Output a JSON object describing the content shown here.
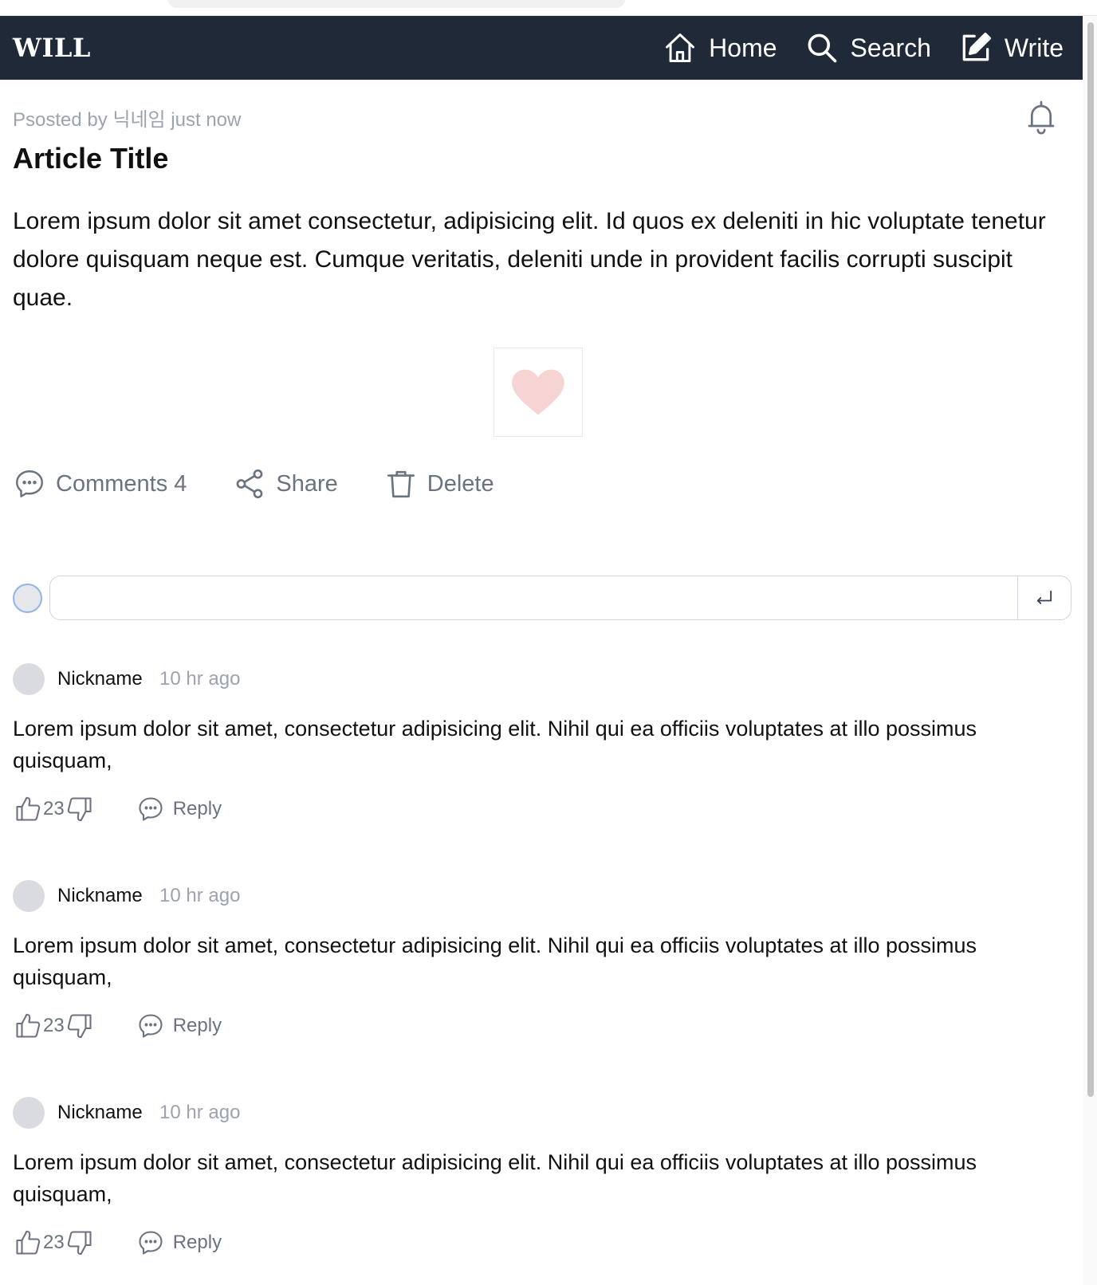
{
  "nav": {
    "logo": "WILL",
    "home_label": "Home",
    "search_label": "Search",
    "write_label": "Write"
  },
  "article": {
    "meta": "Psosted by 닉네임 just now",
    "title": "Article Title",
    "body": "Lorem ipsum dolor sit amet consectetur, adipisicing elit. Id quos ex deleniti in hic voluptate tenetur dolore quisquam neque est. Cumque veritatis, deleniti unde in provident facilis corrupti suscipit quae."
  },
  "actions": {
    "comments_label": "Comments 4",
    "share_label": "Share",
    "delete_label": "Delete"
  },
  "comment_form": {
    "placeholder": ""
  },
  "comments": [
    {
      "nickname": "Nickname",
      "time": "10 hr ago",
      "text": "Lorem ipsum dolor sit amet, consectetur adipisicing elit. Nihil qui ea officiis voluptates at illo possimus quisquam,",
      "likes": "23",
      "reply_label": "Reply"
    },
    {
      "nickname": "Nickname",
      "time": "10 hr ago",
      "text": "Lorem ipsum dolor sit amet, consectetur adipisicing elit. Nihil qui ea officiis voluptates at illo possimus quisquam,",
      "likes": "23",
      "reply_label": "Reply"
    },
    {
      "nickname": "Nickname",
      "time": "10 hr ago",
      "text": "Lorem ipsum dolor sit amet, consectetur adipisicing elit. Nihil qui ea officiis voluptates at illo possimus quisquam,",
      "likes": "23",
      "reply_label": "Reply"
    }
  ],
  "colors": {
    "navbar_bg": "#1f2937",
    "muted_text": "#9ca3af",
    "icon_gray": "#6b7280",
    "heart": "#f6d4d4"
  }
}
